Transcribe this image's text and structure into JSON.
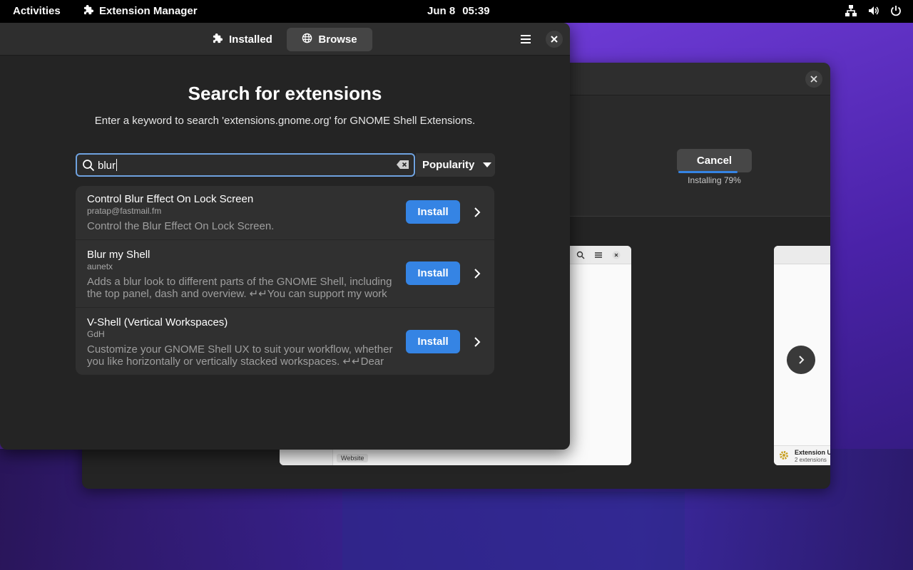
{
  "topbar": {
    "activities": "Activities",
    "app_name": "Extension Manager",
    "date": "Jun 8",
    "time": "05:39",
    "tray_icons": [
      "network-icon",
      "volume-icon",
      "power-icon"
    ]
  },
  "window": {
    "tabs": [
      {
        "label": "Installed",
        "icon": "puzzle-icon",
        "active": false
      },
      {
        "label": "Browse",
        "icon": "globe-icon",
        "active": true
      }
    ],
    "title": "Search for extensions",
    "subtitle": "Enter a keyword to search 'extensions.gnome.org' for GNOME Shell Extensions.",
    "search": {
      "value": "blur"
    },
    "sort": {
      "selected": "Popularity"
    },
    "results": [
      {
        "name": "Control Blur Effect On Lock Screen",
        "author": "pratap@fastmail.fm",
        "description": "Control the Blur Effect On Lock Screen.",
        "button": "Install"
      },
      {
        "name": "Blur my Shell",
        "author": "aunetx",
        "description": "Adds a blur look to different parts of the GNOME Shell, including the top panel, dash and overview. ↵↵You can support my work by…",
        "button": "Install"
      },
      {
        "name": "V-Shell (Vertical Workspaces)",
        "author": "GdH",
        "description": "Customize your GNOME Shell UX to suit your workflow, whether you like horizontally or vertically stacked workspaces. ↵↵Dear us…",
        "button": "Install"
      }
    ]
  },
  "background_window": {
    "cancel_label": "Cancel",
    "status": "Installing 79%",
    "progress_percent": 79,
    "screenshot_website_label": "Website",
    "screenshot2_title": "Extension U",
    "screenshot2_subtitle": "2 extensions"
  },
  "colors": {
    "accent": "#3584e4",
    "window_bg": "#242424",
    "header_bg": "#2e2e2e"
  }
}
